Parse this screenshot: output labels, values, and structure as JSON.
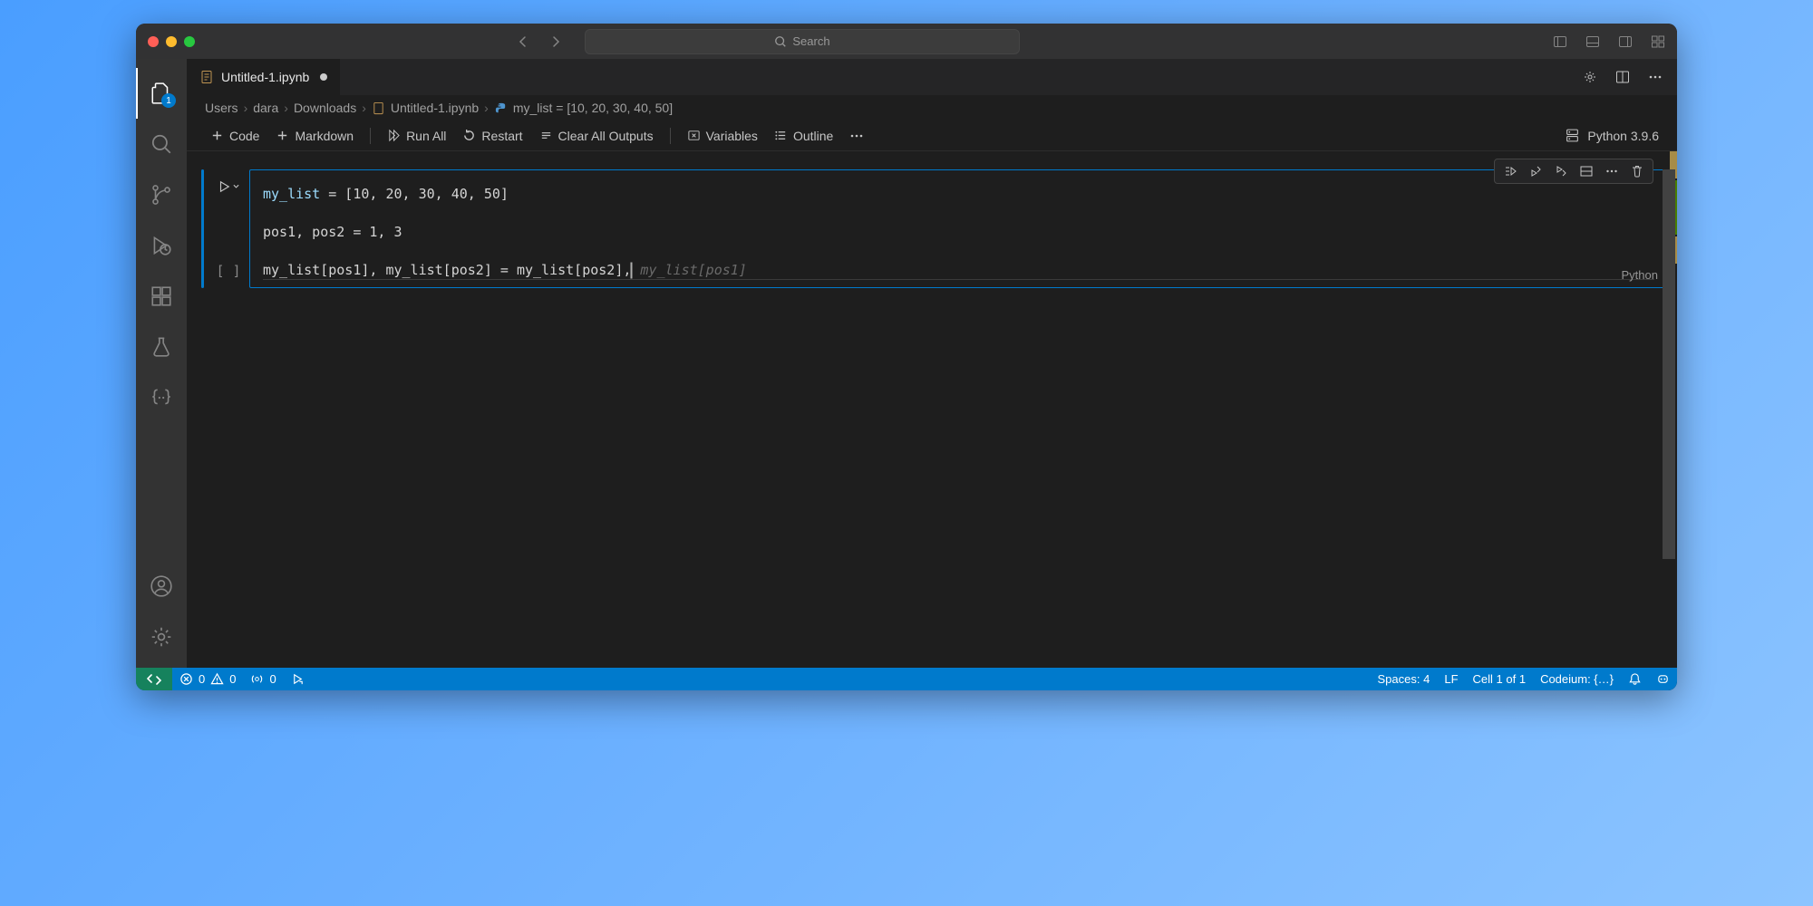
{
  "titlebar": {
    "search_placeholder": "Search"
  },
  "activity": {
    "badge_files": "1"
  },
  "tab": {
    "name": "Untitled-1.ipynb"
  },
  "breadcrumbs": {
    "p0": "Users",
    "p1": "dara",
    "p2": "Downloads",
    "p3": "Untitled-1.ipynb",
    "symbol": "my_list = [10, 20, 30, 40, 50]"
  },
  "toolbar": {
    "code": "Code",
    "markdown": "Markdown",
    "run_all": "Run All",
    "restart": "Restart",
    "clear": "Clear All Outputs",
    "variables": "Variables",
    "outline": "Outline",
    "kernel": "Python 3.9.6"
  },
  "cell": {
    "state": "[ ]",
    "language": "Python",
    "code": {
      "l1_var": "my_list",
      "l1_rest": " = [10, 20, 30, 40, 50]",
      "l2": "",
      "l3": "pos1, pos2 = 1, 3",
      "l4": "",
      "l5_typed": "my_list[pos1], my_list[pos2] = my_list[pos2],",
      "l5_ghost": " my_list[pos1]"
    }
  },
  "statusbar": {
    "errors": "0",
    "warnings": "0",
    "ports": "0",
    "spaces": "Spaces: 4",
    "eol": "LF",
    "cell": "Cell 1 of 1",
    "codeium": "Codeium: {…}"
  }
}
